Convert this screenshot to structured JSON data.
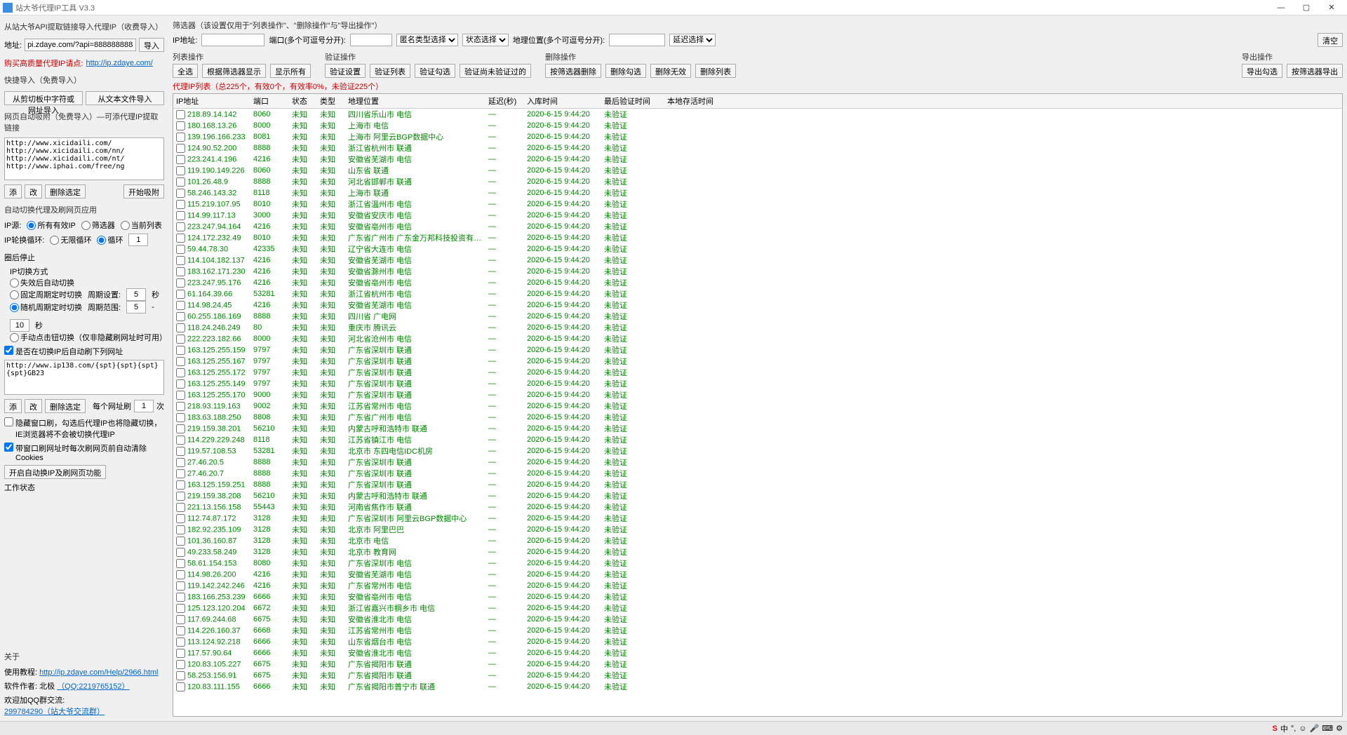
{
  "window": {
    "title": "站大爷代理IP工具 V3.3"
  },
  "sidebar": {
    "api_section": "从站大爷API提取链接导入代理IP（收费导入）",
    "addr_label": "地址:",
    "addr_value": "pi.zdaye.com/?api=8888888888888888",
    "import_btn": "导入",
    "buy_text": "购买高质量代理IP请点: ",
    "buy_link": "http://ip.zdaye.com/",
    "quick_import": "快捷导入（免费导入）",
    "clipboard_btn": "从剪切板中字符或网址导入",
    "textfile_btn": "从文本文件导入",
    "webattach": "网页自动吸附（免费导入）—可添代理IP提取链接",
    "attach_list": "http://www.xicidaili.com/\nhttp://www.xicidaili.com/nn/\nhttp://www.xicidaili.com/nt/\nhttp://www.iphai.com/free/ng",
    "add_btn": "添",
    "mod_btn": "改",
    "del_sel_btn": "删除选定",
    "start_attach_btn": "开始吸附",
    "autoswitch": "自动切换代理及刷网页应用",
    "ip_source": "IP源:",
    "all_valid": "所有有效IP",
    "filter_ip": "筛选器",
    "cur_list": "当前列表",
    "loop_label": "IP轮换循环:",
    "no_loop": "无限循环",
    "loop": "循环",
    "loop_val": "1",
    "loop_suffix": "圈后停止",
    "switch_mode": "IP切换方式",
    "mode_timeout": "失效后自动切换",
    "mode_fixed": "固定周期定时切换",
    "period_label": "周期设置:",
    "period_val": "5",
    "sec": "秒",
    "mode_random": "随机周期定时切换",
    "range_label": "周期范围:",
    "range_min": "5",
    "range_sep": "-",
    "range_max": "10",
    "mode_manual": "手动点击钮切换（仅非隐藏刷网址时可用）",
    "auto_refresh_chk": "是否在切换IP后自动刷下列网址",
    "url_list": "http://www.ip138.com/{spt}{spt}{spt}{spt}GB23",
    "per_url_label": "每个网址刷",
    "per_url_val": "1",
    "times": "次",
    "hidden_chk": "隐藏窗口刷，勾选后代理IP也将隐藏切换，IE浏览器将不会被切换代理IP",
    "cookie_chk": "带窗口刷网址时每次刷网页前自动清除Cookies",
    "start_func_btn": "开启自动换IP及刷网页功能",
    "work_status": "工作状态",
    "about": "关于",
    "tutorial_label": "使用教程: ",
    "tutorial_link": "http://ip.zdaye.com/Help/2966.html",
    "author_label": "软件作者: 北极",
    "author_qq": "（QQ:2219765152）",
    "qq_group_label": "欢迎加QQ群交流: ",
    "qq_group": "299784290（站大爷交流群）"
  },
  "filter": {
    "title": "筛选器（该设置仅用于\"列表操作\"、\"删除操作\"与\"导出操作\"）",
    "ip_label": "IP地址:",
    "port_label": "端口(多个可逗号分开):",
    "anon_label": "匿名类型选择",
    "status_label": "状态选择",
    "geo_label": "地理位置(多个可逗号分开):",
    "delay_label": "延迟选择",
    "clear_btn": "清空"
  },
  "ops": {
    "list": {
      "label": "列表操作",
      "b1": "全选",
      "b2": "根据筛选器显示",
      "b3": "显示所有"
    },
    "verify": {
      "label": "验证操作",
      "b1": "验证设置",
      "b2": "验证列表",
      "b3": "验证勾选",
      "b4": "验证尚未验证过的"
    },
    "delete": {
      "label": "删除操作",
      "b1": "按筛选器删除",
      "b2": "删除勾选",
      "b3": "删除无效",
      "b4": "删除列表"
    },
    "export": {
      "label": "导出操作",
      "b1": "导出勾选",
      "b2": "按筛选器导出"
    }
  },
  "list_title": {
    "p1": "代理IP列表（总225个，有效0个，有效率0%，未验证",
    "p2": "225",
    "p3": "个）"
  },
  "columns": {
    "c0": "",
    "c1": "IP地址",
    "c2": "端口",
    "c3": "状态",
    "c4": "类型",
    "c5": "地理位置",
    "c6": "延迟(秒)",
    "c7": "入库时间",
    "c8": "最后验证时间",
    "c9": "本地存活时间"
  },
  "rows": [
    {
      "ip": "218.89.14.142",
      "port": "8060",
      "status": "未知",
      "type": "未知",
      "geo": "四川省乐山市 电信",
      "delay": "—",
      "time": "2020-6-15 9:44:20",
      "verify": "未验证"
    },
    {
      "ip": "180.168.13.26",
      "port": "8000",
      "status": "未知",
      "type": "未知",
      "geo": "上海市 电信",
      "delay": "—",
      "time": "2020-6-15 9:44:20",
      "verify": "未验证"
    },
    {
      "ip": "139.196.166.233",
      "port": "8081",
      "status": "未知",
      "type": "未知",
      "geo": "上海市 阿里云BGP数据中心",
      "delay": "—",
      "time": "2020-6-15 9:44:20",
      "verify": "未验证"
    },
    {
      "ip": "124.90.52.200",
      "port": "8888",
      "status": "未知",
      "type": "未知",
      "geo": "浙江省杭州市 联通",
      "delay": "—",
      "time": "2020-6-15 9:44:20",
      "verify": "未验证"
    },
    {
      "ip": "223.241.4.196",
      "port": "4216",
      "status": "未知",
      "type": "未知",
      "geo": "安徽省芜湖市 电信",
      "delay": "—",
      "time": "2020-6-15 9:44:20",
      "verify": "未验证"
    },
    {
      "ip": "119.190.149.226",
      "port": "8060",
      "status": "未知",
      "type": "未知",
      "geo": "山东省 联通",
      "delay": "—",
      "time": "2020-6-15 9:44:20",
      "verify": "未验证"
    },
    {
      "ip": "101.26.48.9",
      "port": "8888",
      "status": "未知",
      "type": "未知",
      "geo": "河北省邯郸市 联通",
      "delay": "—",
      "time": "2020-6-15 9:44:20",
      "verify": "未验证"
    },
    {
      "ip": "58.246.143.32",
      "port": "8118",
      "status": "未知",
      "type": "未知",
      "geo": "上海市 联通",
      "delay": "—",
      "time": "2020-6-15 9:44:20",
      "verify": "未验证"
    },
    {
      "ip": "115.219.107.95",
      "port": "8010",
      "status": "未知",
      "type": "未知",
      "geo": "浙江省温州市 电信",
      "delay": "—",
      "time": "2020-6-15 9:44:20",
      "verify": "未验证"
    },
    {
      "ip": "114.99.117.13",
      "port": "3000",
      "status": "未知",
      "type": "未知",
      "geo": "安徽省安庆市 电信",
      "delay": "—",
      "time": "2020-6-15 9:44:20",
      "verify": "未验证"
    },
    {
      "ip": "223.247.94.164",
      "port": "4216",
      "status": "未知",
      "type": "未知",
      "geo": "安徽省亳州市 电信",
      "delay": "—",
      "time": "2020-6-15 9:44:20",
      "verify": "未验证"
    },
    {
      "ip": "124.172.232.49",
      "port": "8010",
      "status": "未知",
      "type": "未知",
      "geo": "广东省广州市 广东金万邦科技投资有限公司(...",
      "delay": "—",
      "time": "2020-6-15 9:44:20",
      "verify": "未验证"
    },
    {
      "ip": "59.44.78.30",
      "port": "42335",
      "status": "未知",
      "type": "未知",
      "geo": "辽宁省大连市 电信",
      "delay": "—",
      "time": "2020-6-15 9:44:20",
      "verify": "未验证"
    },
    {
      "ip": "114.104.182.137",
      "port": "4216",
      "status": "未知",
      "type": "未知",
      "geo": "安徽省芜湖市 电信",
      "delay": "—",
      "time": "2020-6-15 9:44:20",
      "verify": "未验证"
    },
    {
      "ip": "183.162.171.230",
      "port": "4216",
      "status": "未知",
      "type": "未知",
      "geo": "安徽省滁州市 电信",
      "delay": "—",
      "time": "2020-6-15 9:44:20",
      "verify": "未验证"
    },
    {
      "ip": "223.247.95.176",
      "port": "4216",
      "status": "未知",
      "type": "未知",
      "geo": "安徽省亳州市 电信",
      "delay": "—",
      "time": "2020-6-15 9:44:20",
      "verify": "未验证"
    },
    {
      "ip": "61.164.39.66",
      "port": "53281",
      "status": "未知",
      "type": "未知",
      "geo": "浙江省杭州市 电信",
      "delay": "—",
      "time": "2020-6-15 9:44:20",
      "verify": "未验证"
    },
    {
      "ip": "114.98.24.45",
      "port": "4216",
      "status": "未知",
      "type": "未知",
      "geo": "安徽省芜湖市 电信",
      "delay": "—",
      "time": "2020-6-15 9:44:20",
      "verify": "未验证"
    },
    {
      "ip": "60.255.186.169",
      "port": "8888",
      "status": "未知",
      "type": "未知",
      "geo": "四川省 广电网",
      "delay": "—",
      "time": "2020-6-15 9:44:20",
      "verify": "未验证"
    },
    {
      "ip": "118.24.246.249",
      "port": "80",
      "status": "未知",
      "type": "未知",
      "geo": "重庆市 腾讯云",
      "delay": "—",
      "time": "2020-6-15 9:44:20",
      "verify": "未验证"
    },
    {
      "ip": "222.223.182.66",
      "port": "8000",
      "status": "未知",
      "type": "未知",
      "geo": "河北省沧州市 电信",
      "delay": "—",
      "time": "2020-6-15 9:44:20",
      "verify": "未验证"
    },
    {
      "ip": "163.125.255.159",
      "port": "9797",
      "status": "未知",
      "type": "未知",
      "geo": "广东省深圳市 联通",
      "delay": "—",
      "time": "2020-6-15 9:44:20",
      "verify": "未验证"
    },
    {
      "ip": "163.125.255.167",
      "port": "9797",
      "status": "未知",
      "type": "未知",
      "geo": "广东省深圳市 联通",
      "delay": "—",
      "time": "2020-6-15 9:44:20",
      "verify": "未验证"
    },
    {
      "ip": "163.125.255.172",
      "port": "9797",
      "status": "未知",
      "type": "未知",
      "geo": "广东省深圳市 联通",
      "delay": "—",
      "time": "2020-6-15 9:44:20",
      "verify": "未验证"
    },
    {
      "ip": "163.125.255.149",
      "port": "9797",
      "status": "未知",
      "type": "未知",
      "geo": "广东省深圳市 联通",
      "delay": "—",
      "time": "2020-6-15 9:44:20",
      "verify": "未验证"
    },
    {
      "ip": "163.125.255.170",
      "port": "9000",
      "status": "未知",
      "type": "未知",
      "geo": "广东省深圳市 联通",
      "delay": "—",
      "time": "2020-6-15 9:44:20",
      "verify": "未验证"
    },
    {
      "ip": "218.93.119.163",
      "port": "9002",
      "status": "未知",
      "type": "未知",
      "geo": "江苏省常州市 电信",
      "delay": "—",
      "time": "2020-6-15 9:44:20",
      "verify": "未验证"
    },
    {
      "ip": "183.63.188.250",
      "port": "8808",
      "status": "未知",
      "type": "未知",
      "geo": "广东省广州市 电信",
      "delay": "—",
      "time": "2020-6-15 9:44:20",
      "verify": "未验证"
    },
    {
      "ip": "219.159.38.201",
      "port": "56210",
      "status": "未知",
      "type": "未知",
      "geo": "内蒙古呼和浩特市 联通",
      "delay": "—",
      "time": "2020-6-15 9:44:20",
      "verify": "未验证"
    },
    {
      "ip": "114.229.229.248",
      "port": "8118",
      "status": "未知",
      "type": "未知",
      "geo": "江苏省镇江市 电信",
      "delay": "—",
      "time": "2020-6-15 9:44:20",
      "verify": "未验证"
    },
    {
      "ip": "119.57.108.53",
      "port": "53281",
      "status": "未知",
      "type": "未知",
      "geo": "北京市 东四电信IDC机房",
      "delay": "—",
      "time": "2020-6-15 9:44:20",
      "verify": "未验证"
    },
    {
      "ip": "27.46.20.5",
      "port": "8888",
      "status": "未知",
      "type": "未知",
      "geo": "广东省深圳市 联通",
      "delay": "—",
      "time": "2020-6-15 9:44:20",
      "verify": "未验证"
    },
    {
      "ip": "27.46.20.7",
      "port": "8888",
      "status": "未知",
      "type": "未知",
      "geo": "广东省深圳市 联通",
      "delay": "—",
      "time": "2020-6-15 9:44:20",
      "verify": "未验证"
    },
    {
      "ip": "163.125.159.251",
      "port": "8888",
      "status": "未知",
      "type": "未知",
      "geo": "广东省深圳市 联通",
      "delay": "—",
      "time": "2020-6-15 9:44:20",
      "verify": "未验证"
    },
    {
      "ip": "219.159.38.208",
      "port": "56210",
      "status": "未知",
      "type": "未知",
      "geo": "内蒙古呼和浩特市 联通",
      "delay": "—",
      "time": "2020-6-15 9:44:20",
      "verify": "未验证"
    },
    {
      "ip": "221.13.156.158",
      "port": "55443",
      "status": "未知",
      "type": "未知",
      "geo": "河南省焦作市 联通",
      "delay": "—",
      "time": "2020-6-15 9:44:20",
      "verify": "未验证"
    },
    {
      "ip": "112.74.87.172",
      "port": "3128",
      "status": "未知",
      "type": "未知",
      "geo": "广东省深圳市 阿里云BGP数据中心",
      "delay": "—",
      "time": "2020-6-15 9:44:20",
      "verify": "未验证"
    },
    {
      "ip": "182.92.235.109",
      "port": "3128",
      "status": "未知",
      "type": "未知",
      "geo": "北京市 阿里巴巴",
      "delay": "—",
      "time": "2020-6-15 9:44:20",
      "verify": "未验证"
    },
    {
      "ip": "101.36.160.87",
      "port": "3128",
      "status": "未知",
      "type": "未知",
      "geo": "北京市 电信",
      "delay": "—",
      "time": "2020-6-15 9:44:20",
      "verify": "未验证"
    },
    {
      "ip": "49.233.58.249",
      "port": "3128",
      "status": "未知",
      "type": "未知",
      "geo": "北京市 教育网",
      "delay": "—",
      "time": "2020-6-15 9:44:20",
      "verify": "未验证"
    },
    {
      "ip": "58.61.154.153",
      "port": "8080",
      "status": "未知",
      "type": "未知",
      "geo": "广东省深圳市 电信",
      "delay": "—",
      "time": "2020-6-15 9:44:20",
      "verify": "未验证"
    },
    {
      "ip": "114.98.26.200",
      "port": "4216",
      "status": "未知",
      "type": "未知",
      "geo": "安徽省芜湖市 电信",
      "delay": "—",
      "time": "2020-6-15 9:44:20",
      "verify": "未验证"
    },
    {
      "ip": "119.142.242.246",
      "port": "4216",
      "status": "未知",
      "type": "未知",
      "geo": "广东省常州市 电信",
      "delay": "—",
      "time": "2020-6-15 9:44:20",
      "verify": "未验证"
    },
    {
      "ip": "183.166.253.239",
      "port": "6666",
      "status": "未知",
      "type": "未知",
      "geo": "安徽省亳州市 电信",
      "delay": "—",
      "time": "2020-6-15 9:44:20",
      "verify": "未验证"
    },
    {
      "ip": "125.123.120.204",
      "port": "6672",
      "status": "未知",
      "type": "未知",
      "geo": "浙江省嘉兴市桐乡市 电信",
      "delay": "—",
      "time": "2020-6-15 9:44:20",
      "verify": "未验证"
    },
    {
      "ip": "117.69.244.68",
      "port": "6675",
      "status": "未知",
      "type": "未知",
      "geo": "安徽省淮北市 电信",
      "delay": "—",
      "time": "2020-6-15 9:44:20",
      "verify": "未验证"
    },
    {
      "ip": "114.226.160.37",
      "port": "6668",
      "status": "未知",
      "type": "未知",
      "geo": "江苏省常州市 电信",
      "delay": "—",
      "time": "2020-6-15 9:44:20",
      "verify": "未验证"
    },
    {
      "ip": "113.124.92.218",
      "port": "6666",
      "status": "未知",
      "type": "未知",
      "geo": "山东省烟台市 电信",
      "delay": "—",
      "time": "2020-6-15 9:44:20",
      "verify": "未验证"
    },
    {
      "ip": "117.57.90.64",
      "port": "6666",
      "status": "未知",
      "type": "未知",
      "geo": "安徽省淮北市 电信",
      "delay": "—",
      "time": "2020-6-15 9:44:20",
      "verify": "未验证"
    },
    {
      "ip": "120.83.105.227",
      "port": "6675",
      "status": "未知",
      "type": "未知",
      "geo": "广东省揭阳市 联通",
      "delay": "—",
      "time": "2020-6-15 9:44:20",
      "verify": "未验证"
    },
    {
      "ip": "58.253.156.91",
      "port": "6675",
      "status": "未知",
      "type": "未知",
      "geo": "广东省揭阳市 联通",
      "delay": "—",
      "time": "2020-6-15 9:44:20",
      "verify": "未验证"
    },
    {
      "ip": "120.83.111.155",
      "port": "6666",
      "status": "未知",
      "type": "未知",
      "geo": "广东省揭阳市普宁市 联通",
      "delay": "—",
      "time": "2020-6-15 9:44:20",
      "verify": "未验证"
    }
  ]
}
